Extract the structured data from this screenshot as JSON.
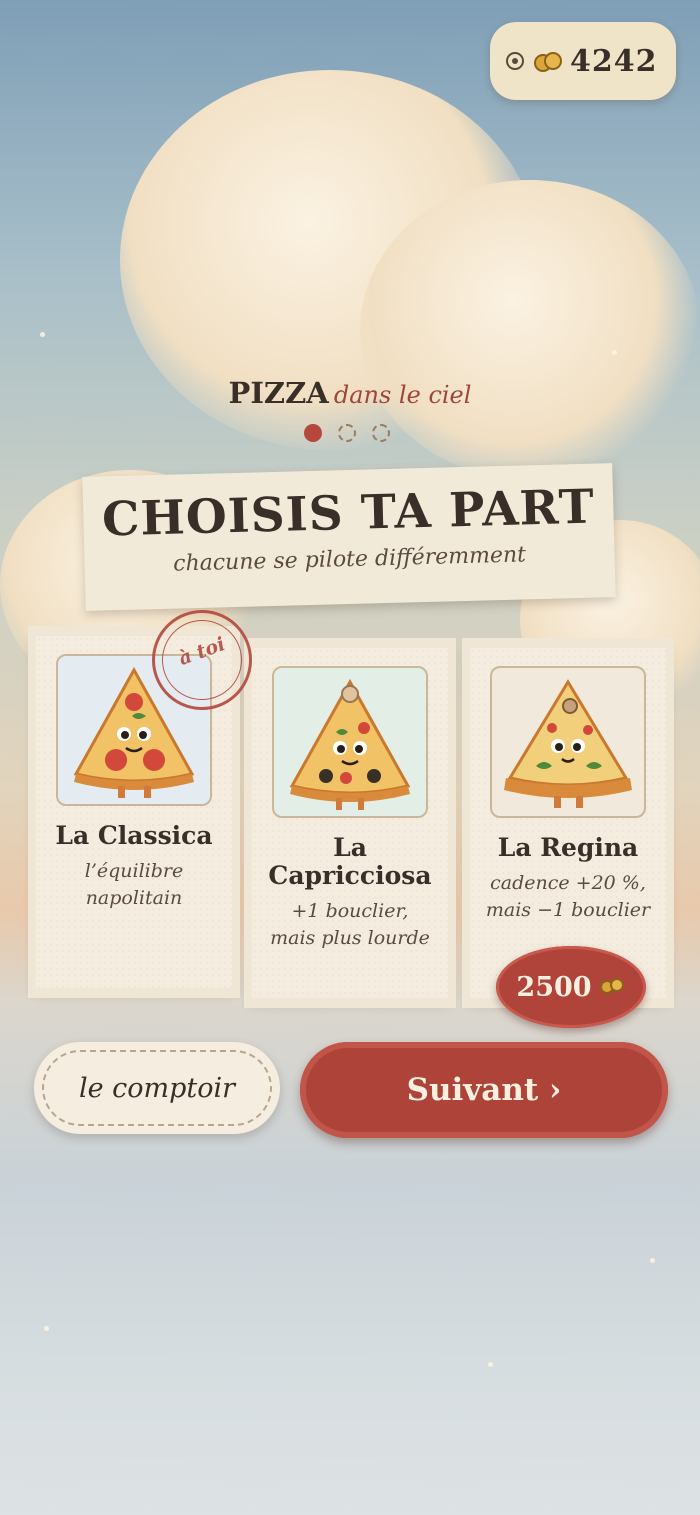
{
  "header": {
    "coins": "4242",
    "ring_icon": "target-icon",
    "coin_icon": "coins-icon"
  },
  "logo": {
    "main": "PIZZA",
    "sub": "dans le ciel"
  },
  "pager": {
    "total": 3,
    "active": 1
  },
  "banner": {
    "title": "CHOISIS TA PART",
    "subtitle": "chacune se pilote différemment"
  },
  "cards": [
    {
      "name": "La Classica",
      "desc1": "l’équilibre",
      "desc2": "napolitain",
      "stamp": "à toi",
      "selected": true
    },
    {
      "name1": "La",
      "name2": "Capricciosa",
      "desc1": "+1 bouclier,",
      "desc2": "mais plus lourde"
    },
    {
      "name": "La Regina",
      "desc1": "cadence +20 %,",
      "desc2": "mais −1 bouclier",
      "price": "2500",
      "locked": true
    }
  ],
  "buttons": {
    "secondary": "le comptoir",
    "primary": "Suivant ›"
  },
  "colors": {
    "accent": "#b0443a",
    "ink": "#3a2f28",
    "paper": "#f3ecdf"
  }
}
